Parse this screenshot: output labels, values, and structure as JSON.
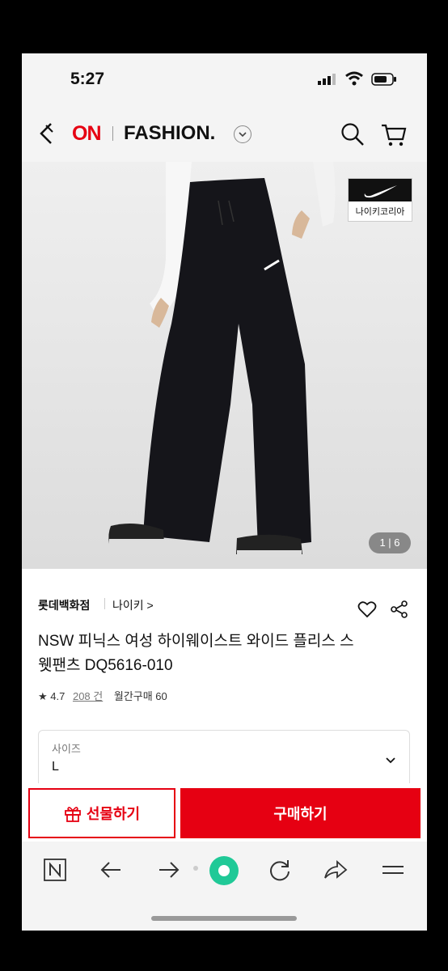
{
  "status": {
    "time": "5:27"
  },
  "header": {
    "logo_on": "ON",
    "logo_fashion": "FASHION."
  },
  "hero": {
    "brand_badge": "나이키코리아",
    "pager": "1 | 6"
  },
  "product": {
    "store": "롯데백화점",
    "brand": "나이키 >",
    "title": "NSW 피닉스 여성 하이웨이스트 와이드 플리스 스웻팬츠 DQ5616-010",
    "rating": "★ 4.7",
    "review_count": "208 건",
    "monthly": "월간구매 60"
  },
  "option": {
    "label": "사이즈",
    "value": "L"
  },
  "actions": {
    "gift_label": "선물하기",
    "buy_label": "구매하기"
  },
  "colors": {
    "accent": "#e60012",
    "green": "#20c997"
  }
}
